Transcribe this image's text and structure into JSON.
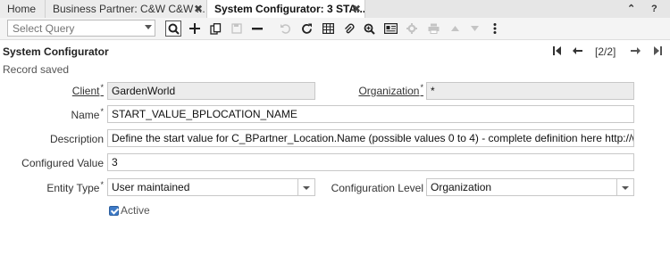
{
  "tabs": [
    {
      "label": "Home",
      "closable": false
    },
    {
      "label": "Business Partner: C&W C&W ...",
      "closable": true
    },
    {
      "label": "System Configurator: 3 STA...",
      "closable": true,
      "active": true
    }
  ],
  "tab_close_glyph": "✖",
  "window_controls": {
    "collapse": "⌃",
    "help": "?"
  },
  "toolbar": {
    "query_placeholder": "Select Query",
    "icons": [
      "search-icon",
      "new-icon",
      "copy-icon",
      "save-icon",
      "delete-icon",
      "undo-icon",
      "refresh-icon",
      "grid-toggle-icon",
      "attachment-icon",
      "zoom-icon",
      "report-icon",
      "settings-icon",
      "print-icon",
      "up-icon",
      "down-icon",
      "more-icon"
    ]
  },
  "header": {
    "title": "System Configurator",
    "record_nav": "[2/2]",
    "status": "Record saved"
  },
  "form": {
    "client_label": "Client",
    "client_value": "GardenWorld",
    "organization_label": "Organization",
    "organization_value": "*",
    "name_label": "Name",
    "name_value": "START_VALUE_BPLOCATION_NAME",
    "description_label": "Description",
    "description_value": "Define the start value for C_BPartner_Location.Name (possible values 0 to 4) - complete definition here http://wiki.idempiere.org",
    "configured_value_label": "Configured Value",
    "configured_value": "3",
    "entity_type_label": "Entity Type",
    "entity_type_value": "User maintained",
    "config_level_label": "Configuration Level",
    "config_level_value": "Organization",
    "active_label": "Active",
    "active_checked": true
  }
}
